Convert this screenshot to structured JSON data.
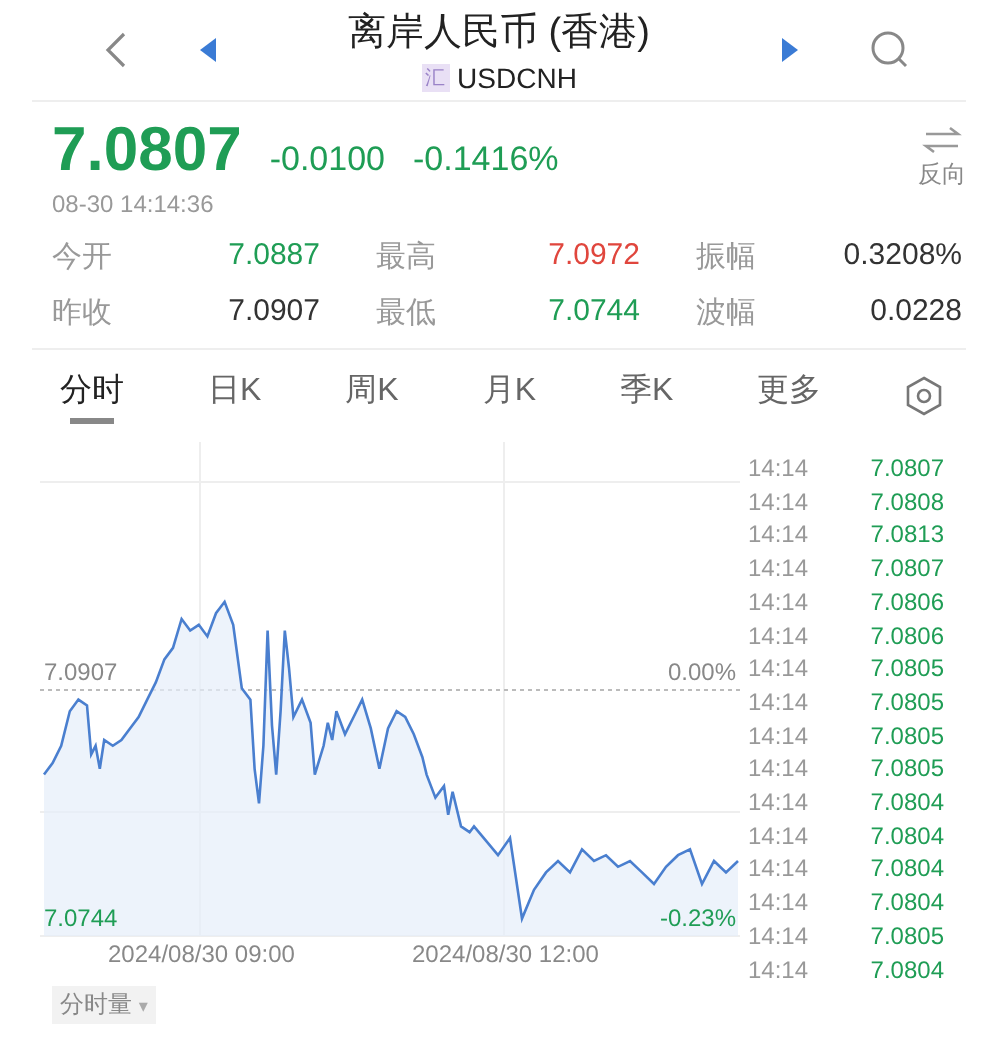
{
  "header": {
    "title": "离岸人民币 (香港)",
    "badge": "汇",
    "symbol": "USDCNH",
    "reverse_label": "反向"
  },
  "quote": {
    "price": "7.0807",
    "change": "-0.0100",
    "change_pct": "-0.1416%",
    "time": "08-30 14:14:36"
  },
  "stats": [
    {
      "label": "今开",
      "value": "7.0887",
      "color": "#1f9d55"
    },
    {
      "label": "最高",
      "value": "7.0972",
      "color": "#e0463d"
    },
    {
      "label": "振幅",
      "value": "0.3208%",
      "color": "#333333"
    },
    {
      "label": "昨收",
      "value": "7.0907",
      "color": "#333333"
    },
    {
      "label": "最低",
      "value": "7.0744",
      "color": "#1f9d55"
    },
    {
      "label": "波幅",
      "value": "0.0228",
      "color": "#333333"
    }
  ],
  "tabs": [
    {
      "label": "分时",
      "selected": true
    },
    {
      "label": "日K",
      "selected": false
    },
    {
      "label": "周K",
      "selected": false
    },
    {
      "label": "月K",
      "selected": false
    },
    {
      "label": "季K",
      "selected": false
    },
    {
      "label": "更多",
      "selected": false
    }
  ],
  "chart": {
    "base_price": "7.0907",
    "base_pct": "0.00%",
    "low_price": "7.0744",
    "low_pct": "-0.23%",
    "x_labels": [
      "2024/08/30 09:00",
      "2024/08/30 12:00"
    ]
  },
  "ticks": [
    {
      "time": "14:14",
      "price": "7.0807"
    },
    {
      "time": "14:14",
      "price": "7.0808"
    },
    {
      "time": "14:14",
      "price": "7.0813"
    },
    {
      "time": "14:14",
      "price": "7.0807"
    },
    {
      "time": "14:14",
      "price": "7.0806"
    },
    {
      "time": "14:14",
      "price": "7.0806"
    },
    {
      "time": "14:14",
      "price": "7.0805"
    },
    {
      "time": "14:14",
      "price": "7.0805"
    },
    {
      "time": "14:14",
      "price": "7.0805"
    },
    {
      "time": "14:14",
      "price": "7.0805"
    },
    {
      "time": "14:14",
      "price": "7.0804"
    },
    {
      "time": "14:14",
      "price": "7.0804"
    },
    {
      "time": "14:14",
      "price": "7.0804"
    },
    {
      "time": "14:14",
      "price": "7.0804"
    },
    {
      "time": "14:14",
      "price": "7.0805"
    },
    {
      "time": "14:14",
      "price": "7.0804"
    }
  ],
  "volume_selector": {
    "label": "分时量",
    "caret": "▾"
  }
}
